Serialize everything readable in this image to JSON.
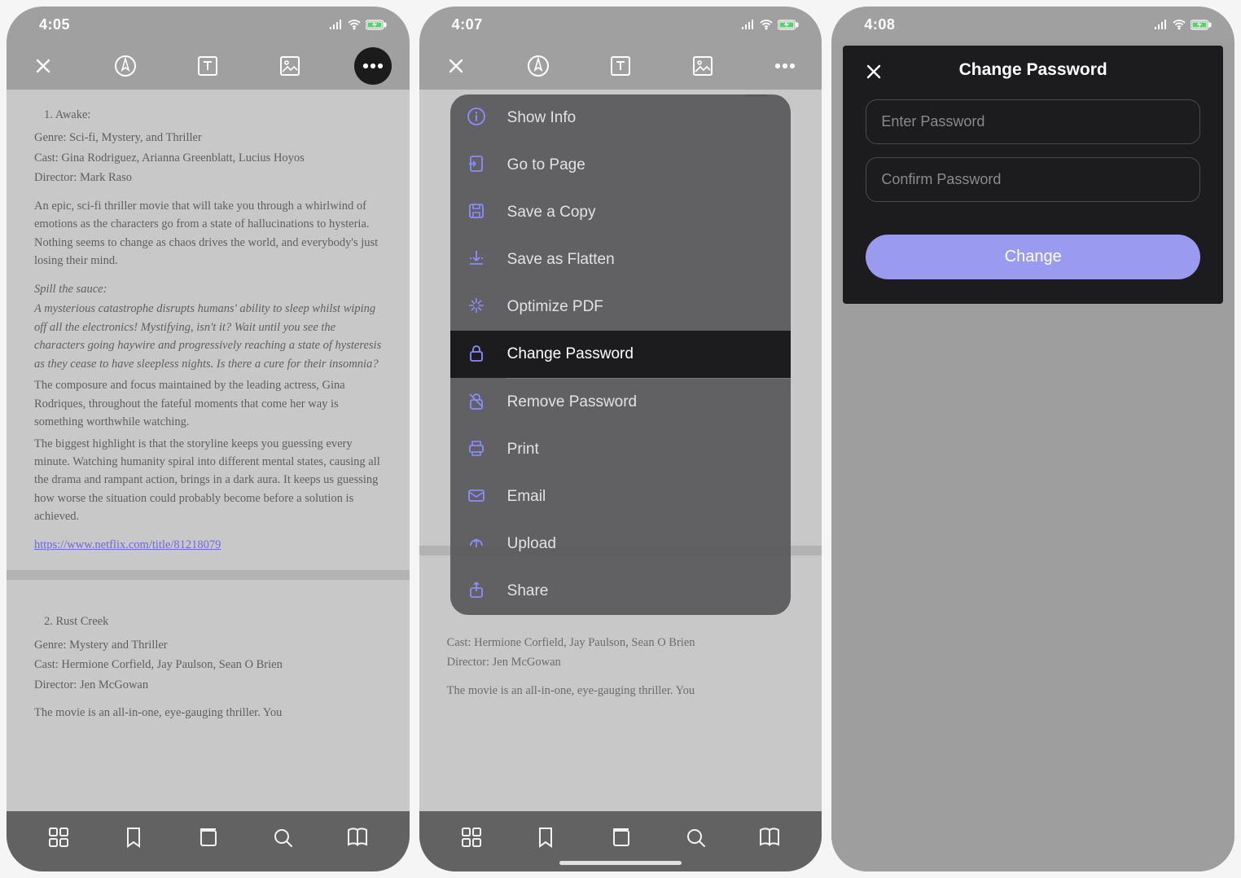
{
  "screens": {
    "s1": {
      "time": "4:05"
    },
    "s2": {
      "time": "4:07"
    },
    "s3": {
      "time": "4:08"
    }
  },
  "doc": {
    "page1": {
      "num_title": "1. Awake:",
      "genre": "Genre: Sci-fi, Mystery, and Thriller",
      "cast": "Cast: Gina Rodriguez, Arianna Greenblatt, Lucius Hoyos",
      "director": "Director: Mark Raso",
      "p1": "An epic, sci-fi thriller movie that will take you through a whirlwind of emotions as the characters go from a state of hallucinations to hysteria. Nothing seems to change as chaos drives the world, and everybody's just losing their mind.",
      "spill_label": "Spill the sauce:",
      "p2": "A mysterious catastrophe disrupts humans' ability to sleep whilst wiping off all the electronics! Mystifying, isn't it? Wait until you see the characters going haywire and progressively reaching a state of hysteresis as they cease to have sleepless nights. Is there a cure for their insomnia?",
      "p3": "The composure and focus maintained by the leading actress, Gina Rodriques, throughout the fateful moments that come her way is something worthwhile watching.",
      "p4": "The biggest highlight is that the storyline keeps you guessing every minute. Watching humanity spiral into different mental states, causing all the drama and rampant action, brings in a dark aura. It keeps us guessing how worse the situation could probably become before a solution is achieved.",
      "link": "https://www.netflix.com/title/81218079"
    },
    "page2": {
      "num_title": "2. Rust Creek",
      "genre": "Genre: Mystery and Thriller",
      "cast": "Cast: Hermione Corfield, Jay Paulson, Sean O Brien",
      "director": "Director: Jen McGowan",
      "p1": "The movie is an all-in-one, eye-gauging thriller. You"
    }
  },
  "menu": {
    "items": [
      {
        "label": "Show Info"
      },
      {
        "label": "Go to Page"
      },
      {
        "label": "Save a Copy"
      },
      {
        "label": "Save as Flatten"
      },
      {
        "label": "Optimize PDF"
      },
      {
        "label": "Change Password"
      },
      {
        "label": "Remove Password"
      },
      {
        "label": "Print"
      },
      {
        "label": "Email"
      },
      {
        "label": "Upload"
      },
      {
        "label": "Share"
      }
    ]
  },
  "dialog": {
    "title": "Change Password",
    "enter_ph": "Enter Password",
    "confirm_ph": "Confirm Password",
    "button": "Change"
  }
}
